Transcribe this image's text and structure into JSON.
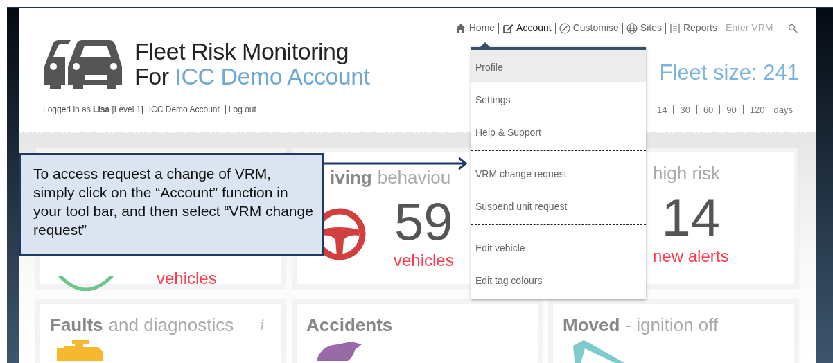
{
  "header": {
    "title_line1": "Fleet Risk Monitoring",
    "title_prefix": "For",
    "account_name": "ICC Demo Account",
    "login_text": "Logged in as **Lisa** [Level 1]",
    "login_account": "ICC Demo Account",
    "logout": "Log out",
    "fleet_size": "Fleet size: 241"
  },
  "nav": [
    {
      "label": "Home",
      "selected": false
    },
    {
      "label": "Account",
      "selected": true
    },
    {
      "label": "Customise",
      "selected": false
    },
    {
      "label": "Sites",
      "selected": false
    },
    {
      "label": "Reports",
      "selected": false
    }
  ],
  "vrm_search": {
    "placeholder": "Enter VRM"
  },
  "periods": {
    "options": [
      "14",
      "30",
      "60",
      "90",
      "120"
    ],
    "unit": "days"
  },
  "dropdown": {
    "items": [
      {
        "kind": "item",
        "label": "Profile",
        "selected": true
      },
      {
        "kind": "item",
        "label": "Settings",
        "selected": false
      },
      {
        "kind": "item",
        "label": "Help & Support",
        "selected": false
      },
      {
        "kind": "divider"
      },
      {
        "kind": "item",
        "label": "VRM change request",
        "selected": false
      },
      {
        "kind": "item",
        "label": "Suspend unit request",
        "selected": false
      },
      {
        "kind": "divider"
      },
      {
        "kind": "item",
        "label": "Edit vehicle",
        "selected": false
      },
      {
        "kind": "item",
        "label": "Edit tag colours",
        "selected": false
      }
    ]
  },
  "cards": [
    {
      "caption": "vehicles"
    },
    {
      "title_bold": "iving",
      "title_light": "behaviou",
      "number": "59",
      "caption": "vehicles"
    },
    {
      "title_light": "high risk",
      "number": "14",
      "caption": "new alerts"
    },
    {
      "title_bold": "Faults",
      "title_light": "and diagnostics",
      "info": "i"
    },
    {
      "title_bold": "Accidents"
    },
    {
      "title_bold": "Moved",
      "title_light": "- ignition off"
    }
  ],
  "callout": {
    "text": "To access request a change of VRM, simply click on the “Account” function in your tool bar, and then select “VRM change request”"
  }
}
